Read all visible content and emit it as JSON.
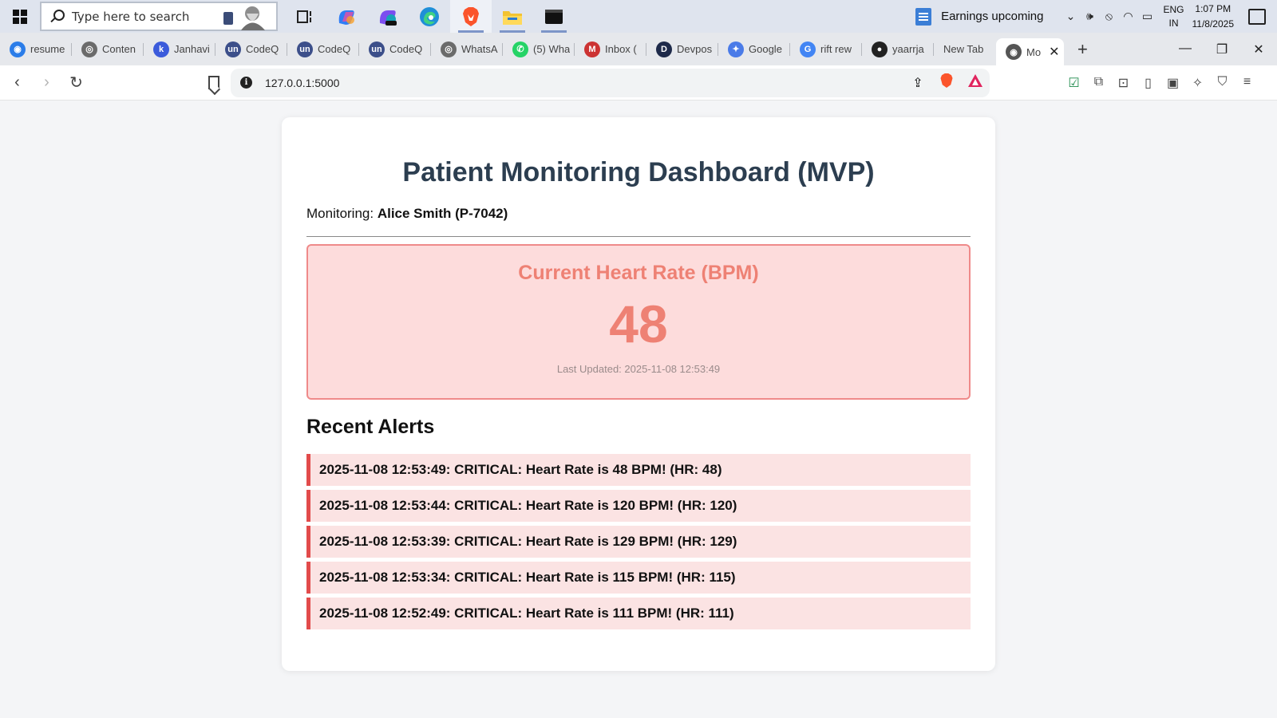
{
  "taskbar": {
    "search_placeholder": "Type here to search",
    "news_text": "Earnings upcoming",
    "lang_top": "ENG",
    "lang_bottom": "IN",
    "time": "1:07 PM",
    "date": "11/8/2025"
  },
  "tabs": [
    {
      "label": "resume",
      "color": "#2b7de9",
      "glyph": "◉"
    },
    {
      "label": "Conten",
      "color": "#6b6b6b",
      "glyph": "◎"
    },
    {
      "label": "Janhavi",
      "color": "#3b5bdb",
      "glyph": "k"
    },
    {
      "label": "CodeQ",
      "color": "#3c4f8a",
      "glyph": "un"
    },
    {
      "label": "CodeQ",
      "color": "#3c4f8a",
      "glyph": "un"
    },
    {
      "label": "CodeQ",
      "color": "#3c4f8a",
      "glyph": "un"
    },
    {
      "label": "WhatsA",
      "color": "#6b6b6b",
      "glyph": "◎"
    },
    {
      "label": "(5) Wha",
      "color": "#25d366",
      "glyph": "✆"
    },
    {
      "label": "Inbox (",
      "color": "#c33",
      "glyph": "M"
    },
    {
      "label": "Devpos",
      "color": "#1e2a4a",
      "glyph": "D"
    },
    {
      "label": "Google",
      "color": "#4a7be8",
      "glyph": "✦"
    },
    {
      "label": "rift rew",
      "color": "#4285f4",
      "glyph": "G"
    },
    {
      "label": "yaarrja",
      "color": "#222",
      "glyph": "●"
    },
    {
      "label": "New Tab",
      "color": "",
      "glyph": ""
    }
  ],
  "active_tab": {
    "label": "Mo",
    "glyph": "◉"
  },
  "address": {
    "url": "127.0.0.1:5000"
  },
  "dashboard": {
    "title": "Patient Monitoring Dashboard (MVP)",
    "monitoring_label": "Monitoring: ",
    "patient": "Alice Smith (P-7042)",
    "hr_label": "Current Heart Rate (BPM)",
    "hr_value": "48",
    "last_updated": "Last Updated: 2025-11-08 12:53:49",
    "alerts_title": "Recent Alerts",
    "alerts": [
      "2025-11-08 12:53:49: CRITICAL: Heart Rate is 48 BPM! (HR: 48)",
      "2025-11-08 12:53:44: CRITICAL: Heart Rate is 120 BPM! (HR: 120)",
      "2025-11-08 12:53:39: CRITICAL: Heart Rate is 129 BPM! (HR: 129)",
      "2025-11-08 12:53:34: CRITICAL: Heart Rate is 115 BPM! (HR: 115)",
      "2025-11-08 12:52:49: CRITICAL: Heart Rate is 111 BPM! (HR: 111)"
    ]
  },
  "colors": {
    "title": "#2c3e50",
    "hr_accent": "#ee8174",
    "hr_box_bg": "#fddcdc",
    "alert_bg": "#fbe3e3",
    "alert_border": "#e24b4b"
  }
}
